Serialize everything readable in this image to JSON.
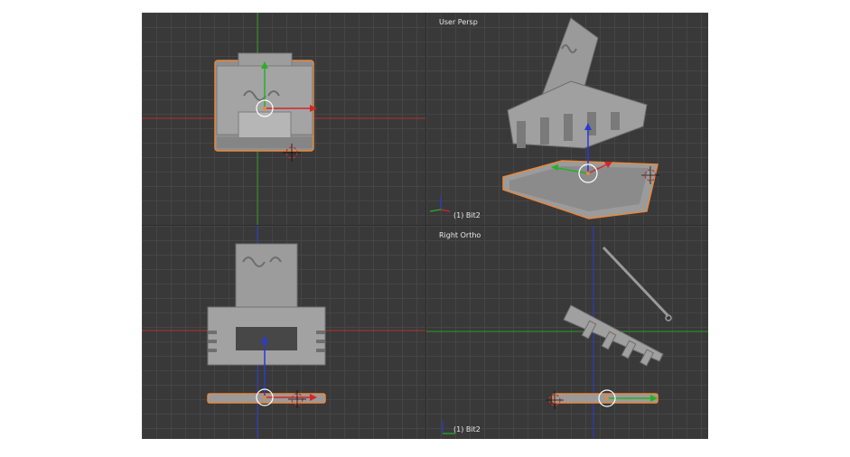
{
  "viewports": {
    "top_left": {
      "view_label": "",
      "object_label": ""
    },
    "top_right": {
      "view_label": "User Persp",
      "object_label": "(1) Bit2"
    },
    "bottom_left": {
      "view_label": "",
      "object_label": ""
    },
    "bottom_right": {
      "view_label": "Right Ortho",
      "object_label": "(1) Bit2"
    }
  },
  "colors": {
    "background": "#393939",
    "grid": "#454545",
    "selection_outline": "#e8883c",
    "axis_x": "#d02828",
    "axis_y": "#27b027",
    "axis_z": "#2a3ad0"
  },
  "icons": [
    "3d-cursor-icon",
    "transform-manipulator-icon",
    "axis-gizmo-icon"
  ]
}
